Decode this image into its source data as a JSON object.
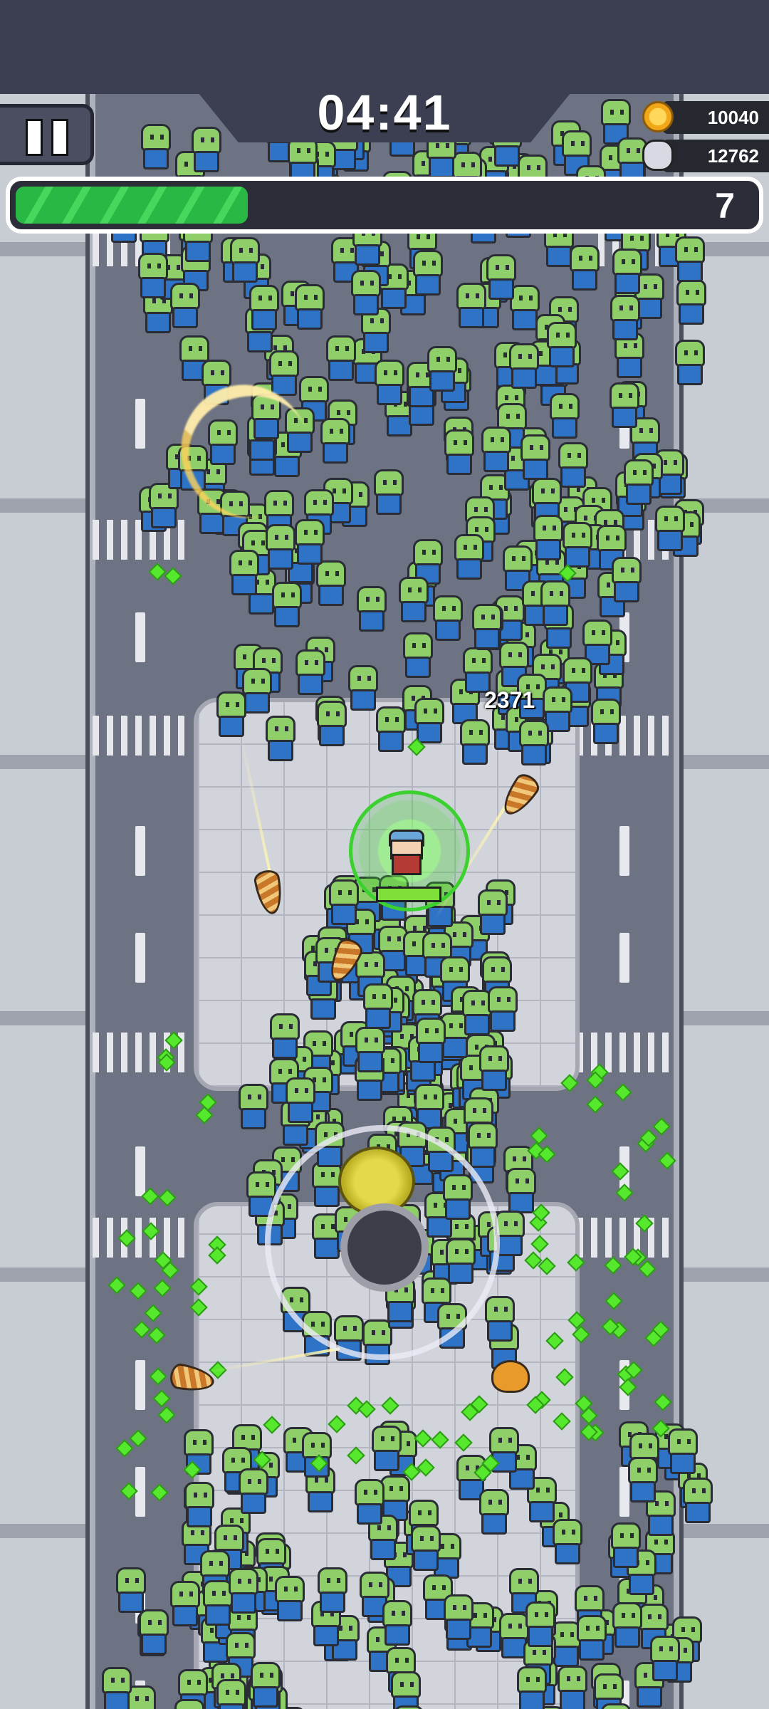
{
  "hud": {
    "timer": "04:41",
    "coins": "10040",
    "kills": "12762",
    "level": "7",
    "xp_progress": 0.31
  },
  "combat": {
    "damage_number": "2371",
    "player_health": 1.0
  },
  "icons": {
    "pause": "pause-icon",
    "coin": "coin-icon",
    "kills": "skull-icon"
  },
  "colors": {
    "zombie_skin": "#8fcf6a",
    "zombie_shirt": "#2f73c6",
    "xp_gem": "#56e82c",
    "xp_bar": "#29b843",
    "aura": "#3bd12f"
  }
}
